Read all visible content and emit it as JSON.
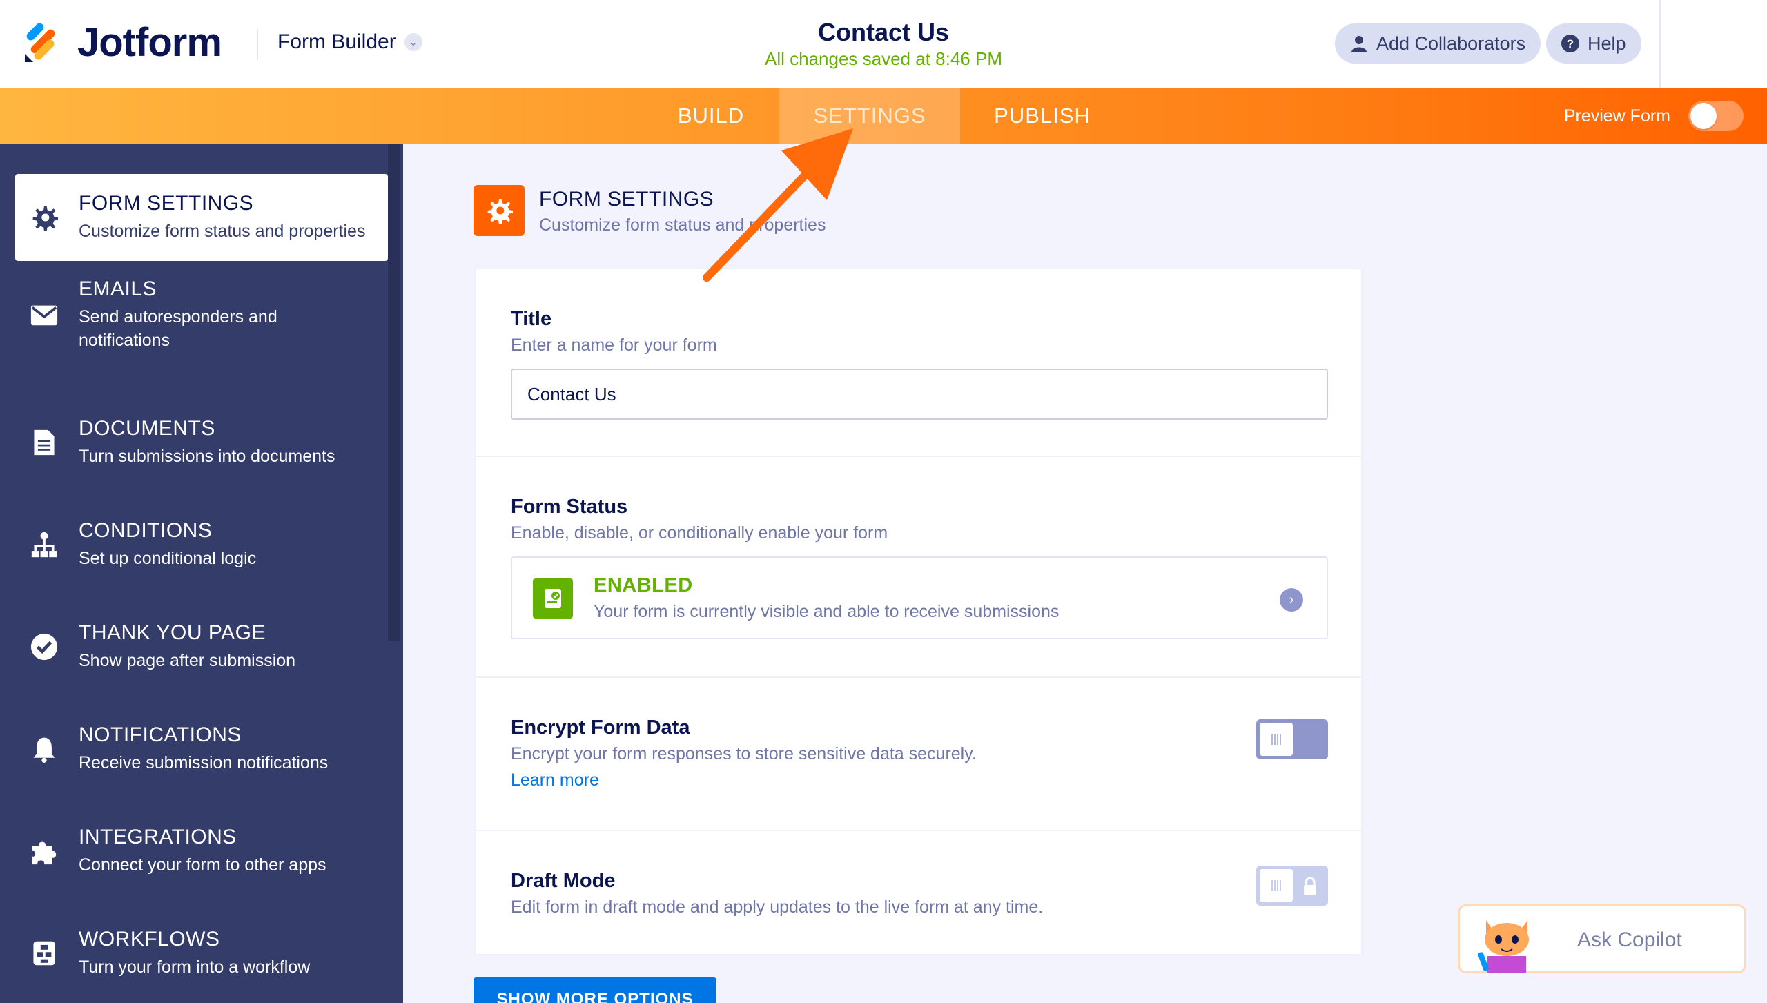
{
  "header": {
    "logo_text": "Jotform",
    "builder_menu": "Form Builder",
    "form_title": "Contact Us",
    "saved_status": "All changes saved at 8:46 PM",
    "add_collaborators": "Add Collaborators",
    "help": "Help"
  },
  "nav": {
    "tabs": [
      {
        "label": "BUILD",
        "active": false
      },
      {
        "label": "SETTINGS",
        "active": true
      },
      {
        "label": "PUBLISH",
        "active": false
      }
    ],
    "preview_label": "Preview Form"
  },
  "sidebar": {
    "items": [
      {
        "title": "FORM SETTINGS",
        "desc": "Customize form status and properties",
        "icon": "gear-icon",
        "active": true
      },
      {
        "title": "EMAILS",
        "desc": "Send autoresponders and notifications",
        "icon": "envelope-icon"
      },
      {
        "title": "DOCUMENTS",
        "desc": "Turn submissions into documents",
        "icon": "document-icon"
      },
      {
        "title": "CONDITIONS",
        "desc": "Set up conditional logic",
        "icon": "hierarchy-icon"
      },
      {
        "title": "THANK YOU PAGE",
        "desc": "Show page after submission",
        "icon": "check-circle-icon"
      },
      {
        "title": "NOTIFICATIONS",
        "desc": "Receive submission notifications",
        "icon": "bell-icon"
      },
      {
        "title": "INTEGRATIONS",
        "desc": "Connect your form to other apps",
        "icon": "puzzle-icon"
      },
      {
        "title": "WORKFLOWS",
        "desc": "Turn your form into a workflow",
        "icon": "workflow-icon"
      }
    ]
  },
  "main": {
    "header_title": "FORM SETTINGS",
    "header_sub": "Customize form status and properties",
    "title_section": {
      "label": "Title",
      "desc": "Enter a name for your form",
      "value": "Contact Us"
    },
    "status_section": {
      "label": "Form Status",
      "desc": "Enable, disable, or conditionally enable your form",
      "status": "ENABLED",
      "status_desc": "Your form is currently visible and able to receive submissions"
    },
    "encrypt_section": {
      "label": "Encrypt Form Data",
      "desc": "Encrypt your form responses to store sensitive data securely.",
      "link": "Learn more"
    },
    "draft_section": {
      "label": "Draft Mode",
      "desc": "Edit form in draft mode and apply updates to the live form at any time."
    },
    "more_button": "SHOW MORE OPTIONS"
  },
  "copilot": {
    "label": "Ask Copilot"
  },
  "colors": {
    "accent": "#ff6100",
    "sidebar": "#343c6a",
    "enabled": "#64b200",
    "link": "#0075e3"
  }
}
